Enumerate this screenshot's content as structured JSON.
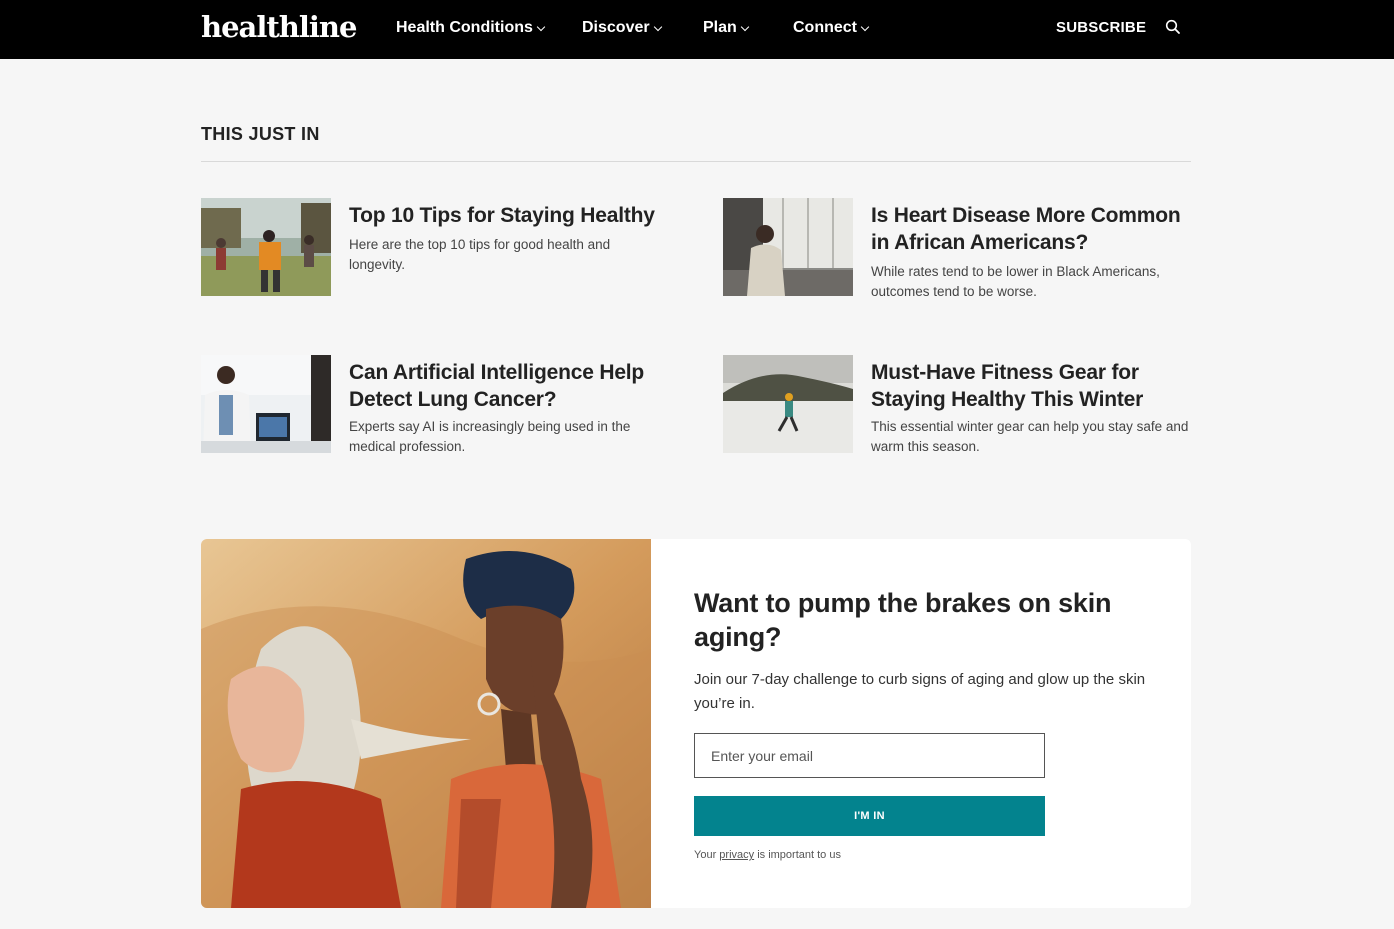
{
  "header": {
    "logo": "healthline",
    "nav": [
      {
        "label": "Health Conditions"
      },
      {
        "label": "Discover"
      },
      {
        "label": "Plan"
      },
      {
        "label": "Connect"
      }
    ],
    "subscribe_label": "SUBSCRIBE",
    "search_icon": "search-icon"
  },
  "section": {
    "title": "THIS JUST IN"
  },
  "articles": [
    {
      "title": "Top 10 Tips for Staying Healthy",
      "desc": "Here are the top 10 tips for good health and longevity."
    },
    {
      "title": "Is Heart Disease More Common in African Americans?",
      "desc": "While rates tend to be lower in Black Americans, outcomes tend to be worse."
    },
    {
      "title": "Can Artificial Intelligence Help Detect Lung Cancer?",
      "desc": "Experts say AI is increasingly being used in the medical profession."
    },
    {
      "title": "Must-Have Fitness Gear for Staying Healthy This Winter",
      "desc": "This essential winter gear can help you stay safe and warm this season."
    }
  ],
  "promo": {
    "title": "Want to pump the brakes on skin aging?",
    "desc": "Join our 7-day challenge to curb signs of aging and glow up the skin you’re in.",
    "email_placeholder": "Enter your email",
    "button_label": "I'M IN",
    "privacy_prefix": "Your",
    "privacy_link": "privacy",
    "privacy_suffix": "is important to us"
  },
  "colors": {
    "header_bg": "#000000",
    "page_bg": "#f6f6f6",
    "cta_bg": "#03838e"
  }
}
